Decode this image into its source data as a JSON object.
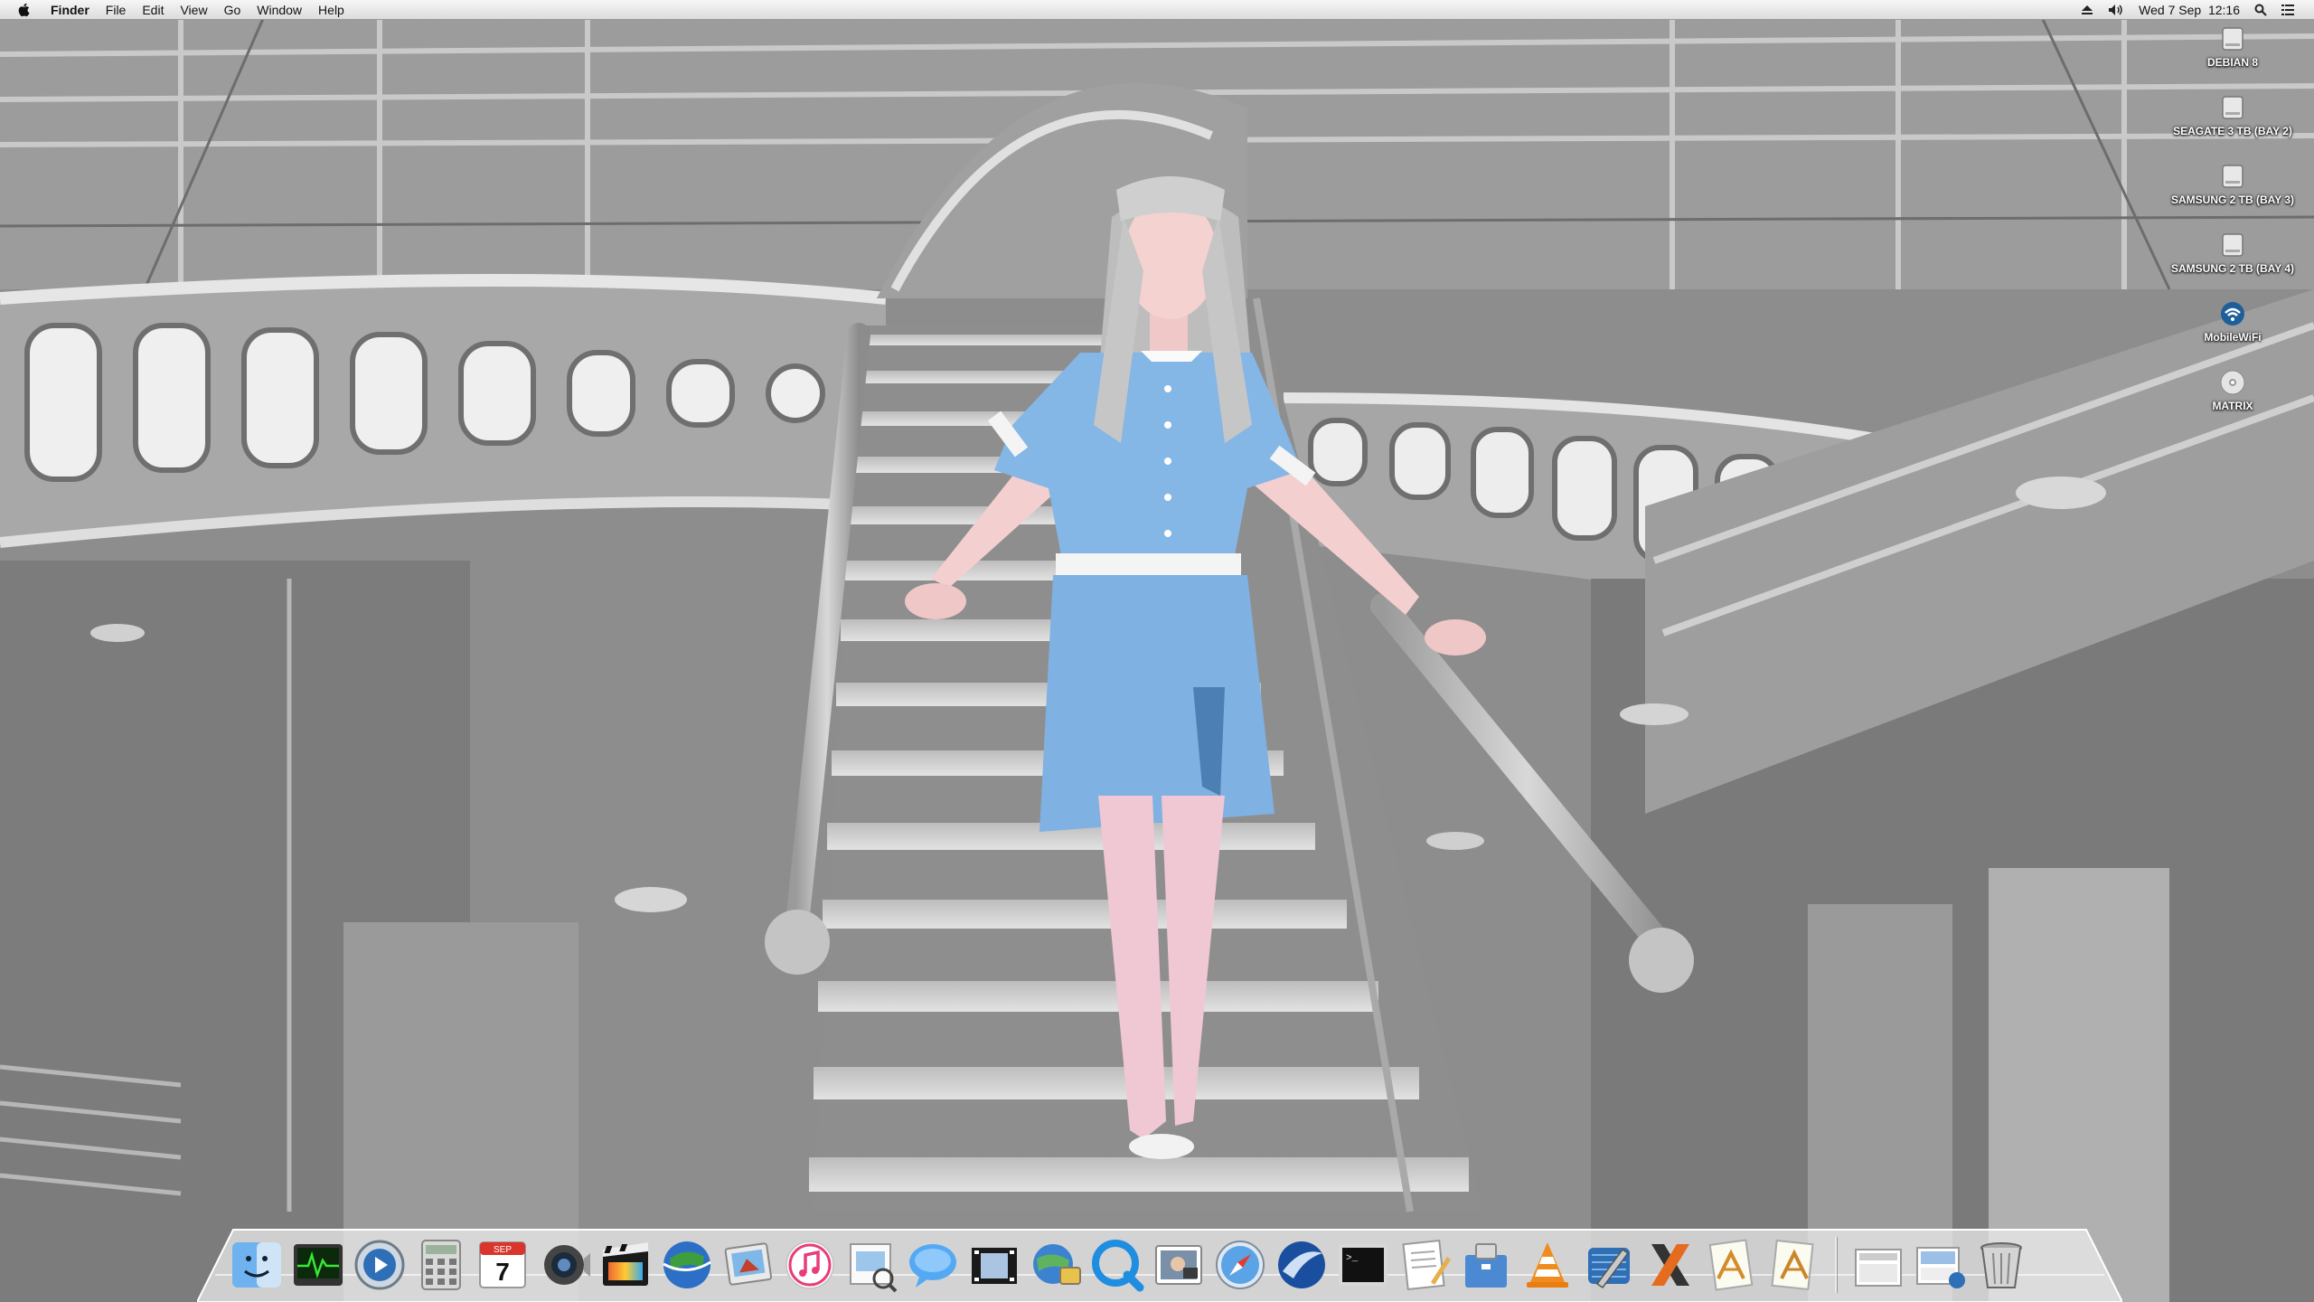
{
  "menubar": {
    "apple_icon": "apple-icon",
    "app_name": "Finder",
    "menus": [
      "File",
      "Edit",
      "View",
      "Go",
      "Window",
      "Help"
    ],
    "datetime": "Wed 7 Sep  12:16",
    "extras": [
      "eject-icon",
      "volume-icon",
      "spotlight-icon",
      "list-icon"
    ]
  },
  "desktop_icons": [
    {
      "label": "DEBIAN 8",
      "icon": "disk-icon"
    },
    {
      "label": "SEAGATE 3 TB (BAY 2)",
      "icon": "disk-icon"
    },
    {
      "label": "SAMSUNG 2 TB (BAY 3)",
      "icon": "disk-icon"
    },
    {
      "label": "SAMSUNG 2 TB (BAY 4)",
      "icon": "disk-icon"
    },
    {
      "label": "MobileWiFi",
      "icon": "wifi-icon"
    },
    {
      "label": "MATRIX",
      "icon": "cd-icon"
    }
  ],
  "dock": {
    "calendar_month": "SEP",
    "calendar_day": "7",
    "apps": [
      "finder-icon",
      "activity-monitor-icon",
      "quicktime-player-icon",
      "calculator-icon",
      "calendar-icon",
      "photo-booth-icon",
      "final-cut-icon",
      "google-earth-icon",
      "iphoto-icon",
      "itunes-icon",
      "preview-icon",
      "messages-icon",
      "imovie-icon",
      "network-utility-icon",
      "quicktime-icon",
      "image-capture-icon",
      "safari-icon",
      "mail-icon",
      "terminal-icon",
      "textedit-icon",
      "archive-utility-icon",
      "vlc-icon",
      "xcode-icon",
      "x11-icon",
      "script-editor-icon",
      "automator-icon"
    ],
    "stacks": [
      "documents-stack-icon",
      "downloads-stack-icon",
      "trash-icon"
    ]
  },
  "colors": {
    "dress_blue": "#84b6e6",
    "wall_gray": "#8a8a8a"
  }
}
